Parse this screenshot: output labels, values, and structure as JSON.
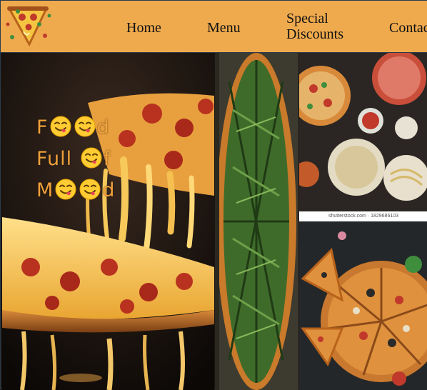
{
  "nav": {
    "home": "Home",
    "menu": "Menu",
    "special_line1": "Special",
    "special_line2": "Discounts",
    "contact": "Contact"
  },
  "hero": {
    "line1_start": "F",
    "line1_end": "d",
    "line2_start": "Full ",
    "line2_end": "f",
    "line3_start": "M",
    "line3_end": "d"
  },
  "photos": {
    "watermark": "shutterstock.com · 1829686103"
  },
  "colors": {
    "header_bg": "#efaa4e",
    "tagline": "#f0a03a"
  },
  "icons": {
    "logo": "pizza-logo-icon",
    "emoji": "face-savoring-food-emoji"
  }
}
